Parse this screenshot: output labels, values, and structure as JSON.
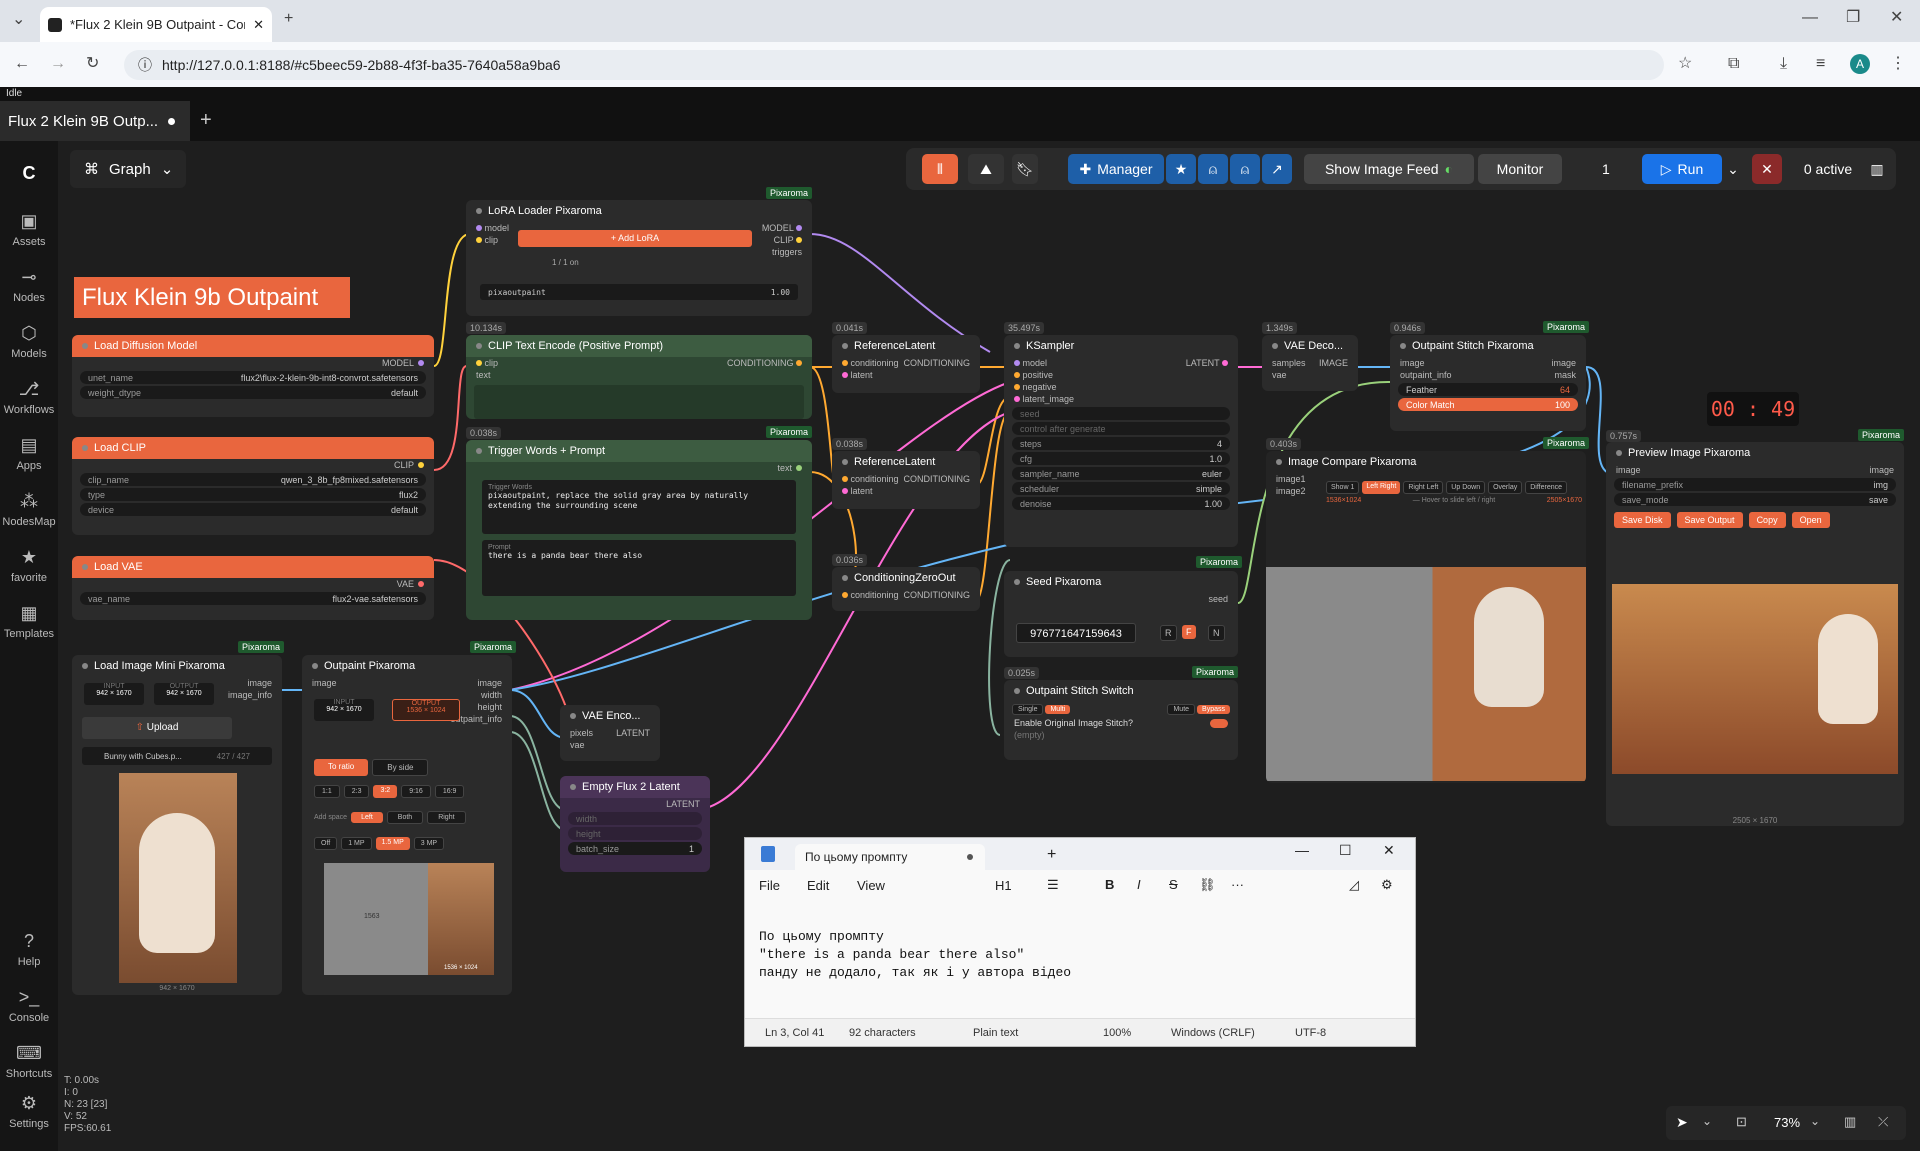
{
  "browser": {
    "tab_title": "*Flux 2 Klein 9B Outpaint - Com",
    "url": "http://127.0.0.1:8188/#c5beec59-2b88-4f3f-ba35-7640a58a9ba6",
    "profile_initial": "A"
  },
  "app": {
    "status": "Idle",
    "workflow_tab": "Flux 2 Klein 9B Outp...",
    "graph_label": "Graph",
    "sidebar": [
      {
        "label": "Assets",
        "icon": "assets-icon"
      },
      {
        "label": "Nodes",
        "icon": "nodes-icon"
      },
      {
        "label": "Models",
        "icon": "models-icon"
      },
      {
        "label": "Workflows",
        "icon": "workflows-icon"
      },
      {
        "label": "Apps",
        "icon": "apps-icon"
      },
      {
        "label": "NodesMap",
        "icon": "nodesmap-icon"
      },
      {
        "label": "favorite",
        "icon": "star-icon"
      },
      {
        "label": "Templates",
        "icon": "templates-icon"
      }
    ],
    "sidebar_bottom": [
      {
        "label": "Help",
        "icon": "help-icon"
      },
      {
        "label": "Console",
        "icon": "console-icon"
      },
      {
        "label": "Shortcuts",
        "icon": "keyboard-icon"
      },
      {
        "label": "Settings",
        "icon": "gear-icon"
      }
    ]
  },
  "toolbar": {
    "manager": "Manager",
    "show_image_feed": "Show Image Feed",
    "monitor": "Monitor",
    "queue_count": "1",
    "run": "Run",
    "active": "0 active"
  },
  "canvas": {
    "title_banner": "Flux Klein 9b Outpaint",
    "timer": "00 : 49",
    "stats": [
      "T: 0.00s",
      "I: 0",
      "N: 23 [23]",
      "V: 52",
      "FPS:60.61"
    ],
    "zoom": "73%"
  },
  "nodes": {
    "load_diffusion": {
      "title": "Load Diffusion Model",
      "out": "MODEL",
      "unet_name_l": "unet_name",
      "unet_name": "flux2\\flux-2-klein-9b-int8-convrot.safetensors",
      "weight_dtype_l": "weight_dtype",
      "weight_dtype": "default"
    },
    "load_clip": {
      "title": "Load CLIP",
      "out": "CLIP",
      "clip_name_l": "clip_name",
      "clip_name": "qwen_3_8b_fp8mixed.safetensors",
      "type_l": "type",
      "type": "flux2",
      "device_l": "device",
      "device": "default"
    },
    "load_vae": {
      "title": "Load VAE",
      "out": "VAE",
      "vae_name_l": "vae_name",
      "vae_name": "flux2-vae.safetensors"
    },
    "lora": {
      "title": "LoRA Loader Pixaroma",
      "brand": "Pixaroma",
      "in1": "model",
      "in2": "clip",
      "out1": "MODEL",
      "out2": "CLIP",
      "out3": "triggers",
      "add": "+ Add LoRA",
      "count": "1 / 1 on",
      "lora_name": "pixaoutpaint",
      "strength": "1.00"
    },
    "clip_text": {
      "title": "CLIP Text Encode (Positive Prompt)",
      "timing": "10.134s",
      "in": "clip",
      "in2": "text",
      "out": "CONDITIONING"
    },
    "trigger": {
      "title": "Trigger Words + Prompt",
      "timing": "0.038s",
      "brand": "Pixaroma",
      "out": "text",
      "trigger_label": "Trigger Words",
      "trigger_text": "pixaoutpaint, replace the solid gray area by naturally extending the surrounding scene",
      "prompt_label": "Prompt",
      "prompt_text": "there is a panda bear there also"
    },
    "ref1": {
      "title": "ReferenceLatent",
      "timing": "0.041s",
      "in1": "conditioning",
      "in2": "latent",
      "out": "CONDITIONING"
    },
    "ref2": {
      "title": "ReferenceLatent",
      "timing": "0.038s",
      "in1": "conditioning",
      "in2": "latent",
      "out": "CONDITIONING"
    },
    "czero": {
      "title": "ConditioningZeroOut",
      "timing": "0.036s",
      "in": "conditioning",
      "out": "CONDITIONING"
    },
    "ksampler": {
      "title": "KSampler",
      "timing": "35.497s",
      "in": [
        "model",
        "positive",
        "negative",
        "latent_image"
      ],
      "out": "LATENT",
      "seed_l": "seed",
      "control": "control after generate",
      "steps_l": "steps",
      "steps": "4",
      "cfg_l": "cfg",
      "cfg": "1.0",
      "sampler_l": "sampler_name",
      "sampler": "euler",
      "scheduler_l": "scheduler",
      "scheduler": "simple",
      "denoise_l": "denoise",
      "denoise": "1.00"
    },
    "vae_decode": {
      "title": "VAE Deco...",
      "timing": "1.349s",
      "in1": "samples",
      "in2": "vae",
      "out": "IMAGE"
    },
    "stitch": {
      "title": "Outpaint Stitch Pixaroma",
      "timing": "0.946s",
      "brand": "Pixaroma",
      "in1": "image",
      "in2": "outpaint_info",
      "out1": "image",
      "out2": "mask",
      "feather_l": "Feather",
      "feather": "64",
      "color_l": "Color Match",
      "color": "100"
    },
    "compare": {
      "title": "Image Compare Pixaroma",
      "timing": "0.403s",
      "brand": "Pixaroma",
      "in1": "image1",
      "in2": "image2",
      "tabs": [
        "Show 1",
        "Left Right",
        "Right Left",
        "Up Down",
        "Overlay",
        "Difference"
      ],
      "size1": "1536×1024",
      "hint": "— Hover to slide left / right",
      "size2": "2505×1670"
    },
    "preview": {
      "title": "Preview Image Pixaroma",
      "timing": "0.757s",
      "brand": "Pixaroma",
      "in": "image",
      "out": "image",
      "prefix_l": "filename_prefix",
      "prefix": "img",
      "mode_l": "save_mode",
      "mode": "save",
      "btns": [
        "Save Disk",
        "Save Output",
        "Copy",
        "Open"
      ],
      "size": "2505 × 1670"
    },
    "seed": {
      "title": "Seed Pixaroma",
      "brand": "Pixaroma",
      "out": "seed",
      "value": "976771647159643",
      "btns": [
        "R",
        "F",
        "N"
      ]
    },
    "switch": {
      "title": "Outpaint Stitch Switch",
      "timing": "0.025s",
      "brand": "Pixaroma",
      "single": "Single",
      "multi": "Multi",
      "mute": "Mute",
      "bypass": "Bypass",
      "enable": "Enable Original Image Stitch?",
      "empty": "(empty)"
    },
    "load_image": {
      "title": "Load Image Mini Pixaroma",
      "brand": "Pixaroma",
      "out1": "image",
      "out2": "image_info",
      "input_l": "INPUT",
      "input": "942 × 1670",
      "output_l": "OUTPUT",
      "output": "942 × 1670",
      "upload": "Upload",
      "file": "Bunny with Cubes.p...",
      "file_idx": "427 / 427",
      "size": "942 × 1670"
    },
    "outpaint": {
      "title": "Outpaint Pixaroma",
      "brand": "Pixaroma",
      "in": "image",
      "outs": [
        "image",
        "width",
        "height",
        "outpaint_info"
      ],
      "input_l": "INPUT",
      "input": "942 × 1670",
      "output_l": "OUTPUT",
      "output": "1536 × 1024",
      "to_ratio": "To ratio",
      "by_side": "By side",
      "ratios": [
        "1:1",
        "2:3",
        "3:2",
        "9:16",
        "16:9"
      ],
      "add_space": "Add space",
      "sides": [
        "Left",
        "Both",
        "Right"
      ],
      "mps": [
        "Off",
        "1 MP",
        "1.5 MP",
        "3 MP"
      ],
      "pad": "1563",
      "size": "1536 × 1024"
    },
    "vae_encode": {
      "title": "VAE Enco...",
      "in1": "pixels",
      "in2": "vae",
      "out": "LATENT"
    },
    "empty_latent": {
      "title": "Empty Flux 2 Latent",
      "out": "LATENT",
      "w": "width",
      "h": "height",
      "batch_l": "batch_size",
      "batch": "1"
    }
  },
  "notepad": {
    "tab": "По цьому промпту",
    "menu": [
      "File",
      "Edit",
      "View"
    ],
    "heading": "H1",
    "line1": "По цьому промпту",
    "line2": "\"there is a panda bear there also\"",
    "line3": "панду не додало, так як і у автора відео",
    "status": [
      "Ln 3, Col 41",
      "92 characters",
      "Plain text",
      "100%",
      "Windows (CRLF)",
      "UTF-8"
    ]
  },
  "colors": {
    "accent": "#e9663e",
    "run_blue": "#1a73e8",
    "manager_blue": "#1e5fa8",
    "green_node": "#2e4733",
    "purple_node": "#3b2a47"
  }
}
